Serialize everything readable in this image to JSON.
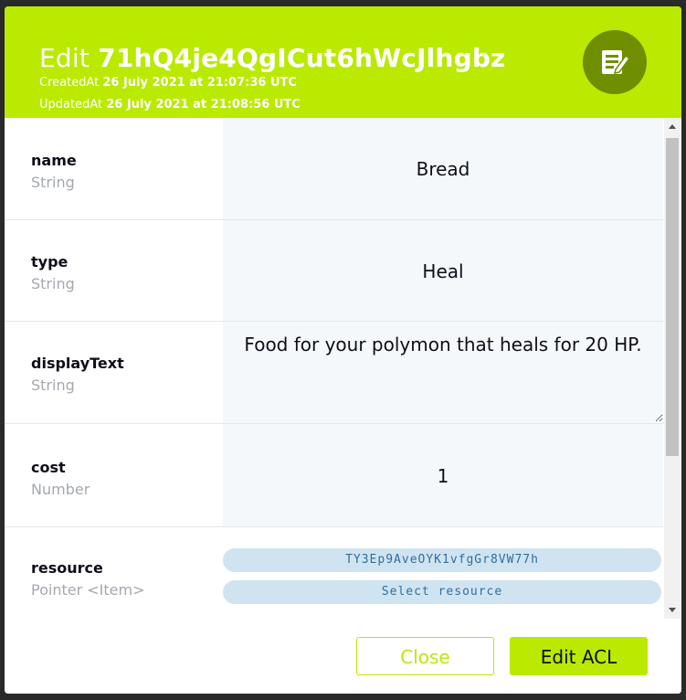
{
  "header": {
    "edit_prefix": "Edit",
    "object_id": "71hQ4je4QgICut6hWcJlhgbz",
    "created_label": "CreatedAt",
    "created_value": "26 July 2021 at 21:07:36 UTC",
    "updated_label": "UpdatedAt",
    "updated_value": "26 July 2021 at 21:08:56 UTC",
    "icon": "edit-note-icon"
  },
  "fields": [
    {
      "name": "name",
      "type": "String",
      "value": "Bread"
    },
    {
      "name": "type",
      "type": "String",
      "value": "Heal"
    },
    {
      "name": "displayText",
      "type": "String",
      "value": "Food for your polymon that heals for 20 HP."
    },
    {
      "name": "cost",
      "type": "Number",
      "value": "1"
    },
    {
      "name": "resource",
      "type": "Pointer <Item>",
      "pointer_id": "TY3Ep9AveOYK1vfgGr8VW77h",
      "select_label": "Select resource"
    }
  ],
  "footer": {
    "close_label": "Close",
    "acl_label": "Edit ACL"
  },
  "colors": {
    "accent": "#b9ea00",
    "icon_circle": "#6f8f00",
    "pill_bg": "#d0e3f0",
    "pill_text": "#2f6fa0"
  }
}
